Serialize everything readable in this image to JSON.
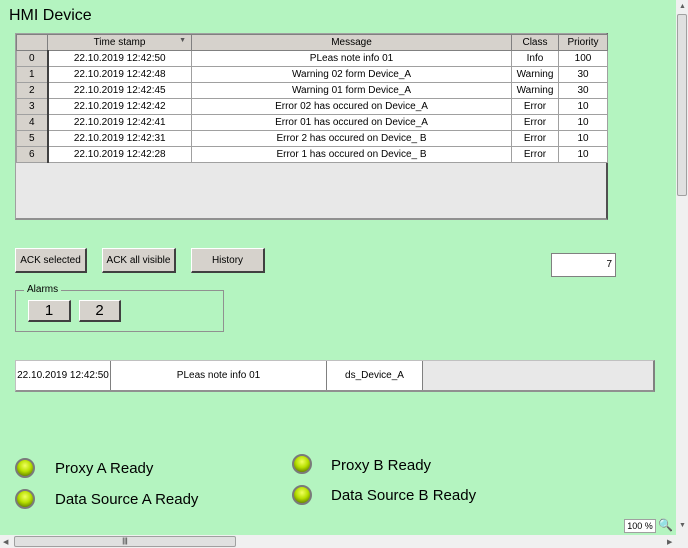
{
  "title": "HMI Device",
  "table": {
    "headers": [
      "",
      "Time stamp",
      "Message",
      "Class",
      "Priority"
    ],
    "rows": [
      [
        "0",
        "22.10.2019 12:42:50",
        "PLeas note info 01",
        "Info",
        "100"
      ],
      [
        "1",
        "22.10.2019 12:42:48",
        "Warning 02 form Device_A",
        "Warning",
        "30"
      ],
      [
        "2",
        "22.10.2019 12:42:45",
        "Warning 01 form Device_A",
        "Warning",
        "30"
      ],
      [
        "3",
        "22.10.2019 12:42:42",
        "Error 02 has occured on Device_A",
        "Error",
        "10"
      ],
      [
        "4",
        "22.10.2019 12:42:41",
        "Error 01 has occured on Device_A",
        "Error",
        "10"
      ],
      [
        "5",
        "22.10.2019 12:42:31",
        "Error 2 has occured on Device_ B",
        "Error",
        "10"
      ],
      [
        "6",
        "22.10.2019 12:42:28",
        "Error 1 has occured on Device_ B",
        "Error",
        "10"
      ]
    ]
  },
  "buttons": {
    "ack_selected": "ACK selected",
    "ack_all": "ACK all visible",
    "history": "History"
  },
  "count_value": "7",
  "alarms": {
    "label": "Alarms",
    "b1": "1",
    "b2": "2"
  },
  "info": {
    "time": "22.10.2019 12:42:50",
    "message": "PLeas note info 01",
    "source": "ds_Device_A"
  },
  "status": {
    "proxy_a": "Proxy A Ready",
    "ds_a": "Data Source A Ready",
    "proxy_b": "Proxy B Ready",
    "ds_b": "Data Source B Ready"
  },
  "zoom": "100 %",
  "colors": {
    "background": "#b4f4c0",
    "led": "#b8e000"
  }
}
